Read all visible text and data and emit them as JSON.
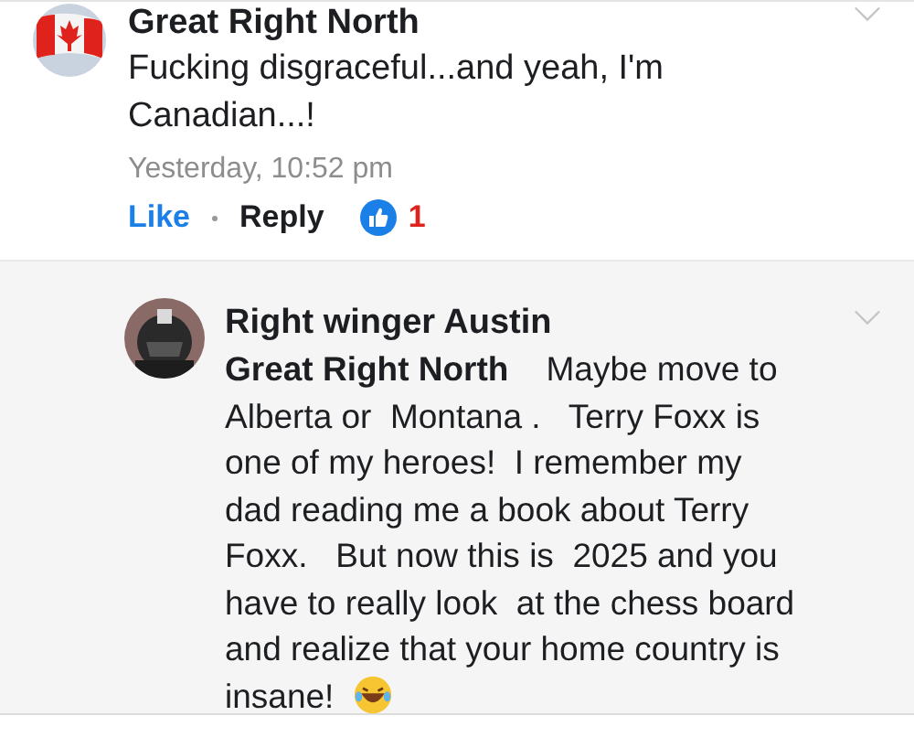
{
  "comment": {
    "author": "Great Right North",
    "text": "Fucking disgraceful...and yeah, I'm Canadian...!",
    "time": "Yesterday, 10:52 pm",
    "actions": [
      {
        "label": "Like",
        "kind": "like"
      },
      {
        "label": "Reply",
        "kind": "reply"
      }
    ],
    "reaction_count": "1"
  },
  "reply": {
    "author": "Right winger Austin",
    "text": "**Great Right North**    Maybe move to  Alberta or  Montana .   Terry Foxx is one of my heroes!  I remember my dad reading me a book about Terry Foxx.   But now this is  2025 and you have to really look  at the chess board and realize that your home country is insane!  "
  }
}
